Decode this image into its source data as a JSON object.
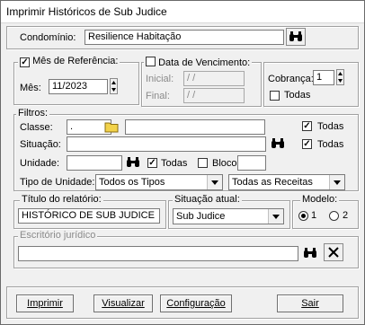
{
  "window": {
    "title": "Imprimir Históricos de Sub Judice"
  },
  "condominio": {
    "label": "Condomínio:",
    "value": "Resilience Habitação"
  },
  "mes_referencia": {
    "label": "Mês de Referência:",
    "checked": true,
    "mes_label": "Mês:",
    "mes_value": "11/2023"
  },
  "data_vencimento": {
    "label": "Data de Vencimento:",
    "checked": false,
    "inicial_label": "Inicial:",
    "inicial_value": "/ /",
    "final_label": "Final:",
    "final_value": "/ /"
  },
  "cobranca": {
    "label": "Cobrança:",
    "value": "1",
    "todas_label": "Todas"
  },
  "filtros": {
    "label": "Filtros:",
    "classe_label": "Classe:",
    "classe_value": ".",
    "todas1_label": "Todas",
    "situacao_label": "Situação:",
    "todas2_label": "Todas",
    "unidade_label": "Unidade:",
    "unidade_todas_label": "Todas",
    "bloco_label": "Bloco",
    "tipo_label": "Tipo de Unidade:",
    "tipo_value": "Todos os Tipos",
    "receitas_value": "Todas as Receitas"
  },
  "titulo": {
    "label": "Título do relatório:",
    "value": "HISTÓRICO DE SUB JUDICE"
  },
  "situacao_atual": {
    "label": "Situação atual:",
    "value": "Sub Judice"
  },
  "modelo": {
    "label": "Modelo:",
    "opt1": "1",
    "opt2": "2"
  },
  "escritorio": {
    "label": "Escritório jurídico"
  },
  "buttons": {
    "imprimir": "Imprimir",
    "visualizar": "Visualizar",
    "configuracao": "Configuração",
    "sair": "Sair"
  }
}
